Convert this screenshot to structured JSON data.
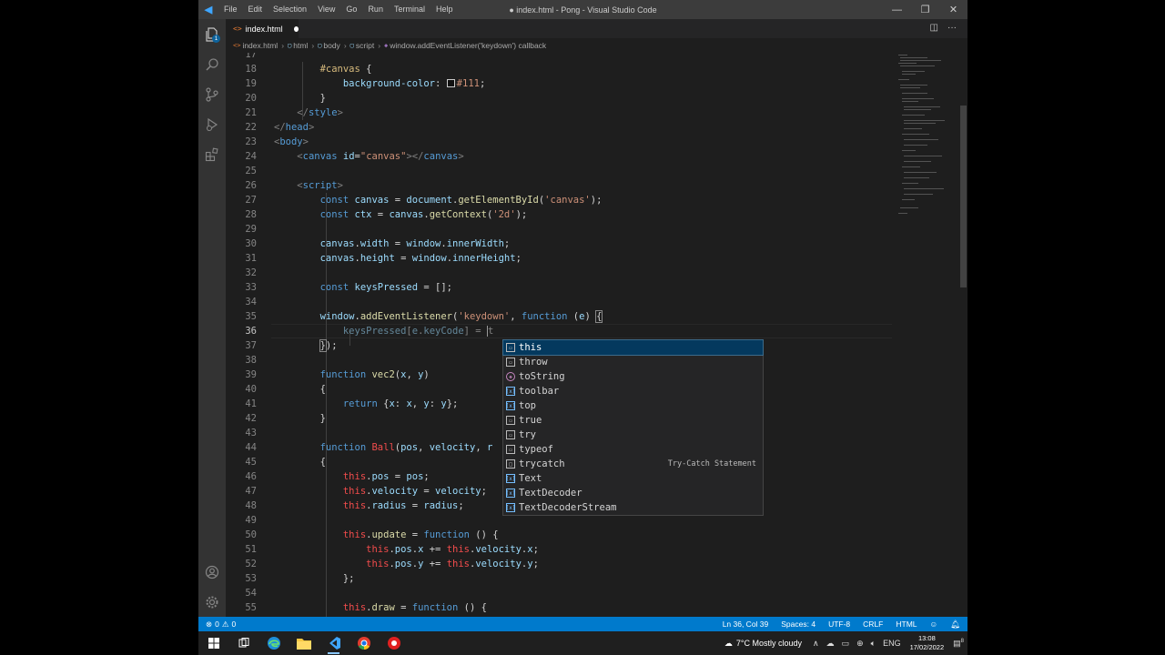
{
  "titlebar": {
    "menus": [
      "File",
      "Edit",
      "Selection",
      "View",
      "Go",
      "Run",
      "Terminal",
      "Help"
    ],
    "title": "● index.html - Pong - Visual Studio Code"
  },
  "activity": {
    "explorer_badge": "1"
  },
  "tab": {
    "filename": "index.html",
    "icon": "<>"
  },
  "breadcrumb": [
    "index.html",
    "html",
    "body",
    "script",
    "window.addEventListener('keydown') callback"
  ],
  "editor": {
    "current_line": 36
  },
  "suggest": {
    "items": [
      {
        "label": "this",
        "kind": "keyword"
      },
      {
        "label": "throw",
        "kind": "keyword"
      },
      {
        "label": "toString",
        "kind": "method"
      },
      {
        "label": "toolbar",
        "kind": "variable"
      },
      {
        "label": "top",
        "kind": "variable"
      },
      {
        "label": "true",
        "kind": "keyword"
      },
      {
        "label": "try",
        "kind": "keyword"
      },
      {
        "label": "typeof",
        "kind": "keyword"
      },
      {
        "label": "trycatch",
        "kind": "snippet",
        "detail": "Try-Catch Statement"
      },
      {
        "label": "Text",
        "kind": "variable"
      },
      {
        "label": "TextDecoder",
        "kind": "variable"
      },
      {
        "label": "TextDecoderStream",
        "kind": "variable"
      }
    ]
  },
  "status": {
    "errors": "0",
    "warnings": "0",
    "position": "Ln 36, Col 39",
    "spaces": "Spaces: 4",
    "encoding": "UTF-8",
    "eol": "CRLF",
    "language": "HTML"
  },
  "taskbar": {
    "weather": "7°C  Mostly cloudy",
    "lang": "ENG",
    "time": "13:08",
    "date": "17/02/2022",
    "notifications": "8"
  },
  "colors": {
    "accent": "#007acc",
    "editor_bg": "#1e1e1e"
  }
}
